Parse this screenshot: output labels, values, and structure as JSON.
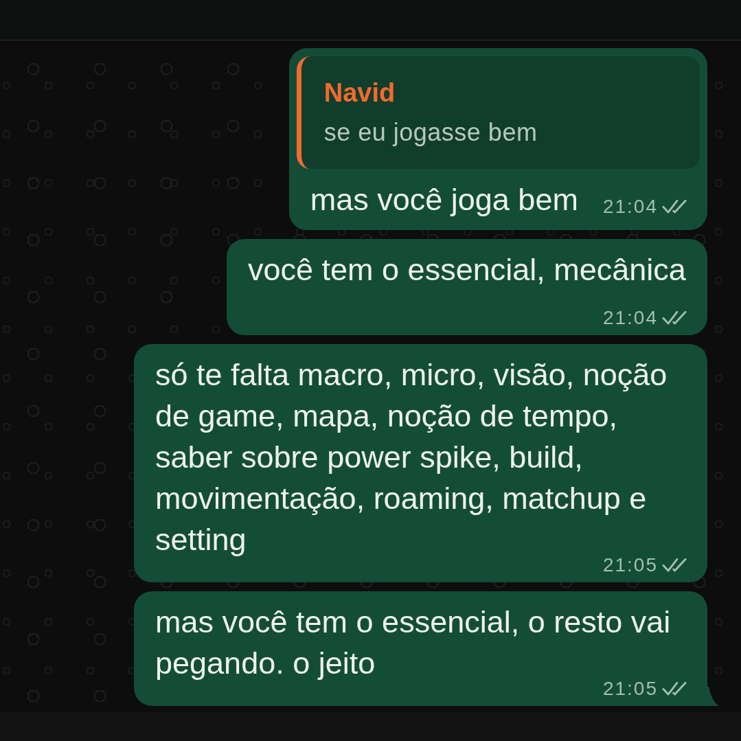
{
  "messages": [
    {
      "outgoing": true,
      "quote": {
        "author": "Navid",
        "text": "se eu jogasse bem"
      },
      "text": "mas você joga bem",
      "time": "21:04",
      "read": false,
      "tail": false
    },
    {
      "outgoing": true,
      "text": "você tem o essencial, mecânica",
      "time": "21:04",
      "read": false,
      "tail": false
    },
    {
      "outgoing": true,
      "text": "só te falta macro, micro, visão, noção de game, mapa, noção de tempo, saber sobre power spike, build, movimentação, roaming, matchup e setting",
      "time": "21:05",
      "read": false,
      "tail": false
    },
    {
      "outgoing": true,
      "text": "mas você tem o essencial, o resto vai pegando. o jeito",
      "time": "21:05",
      "read": false,
      "tail": true
    }
  ]
}
